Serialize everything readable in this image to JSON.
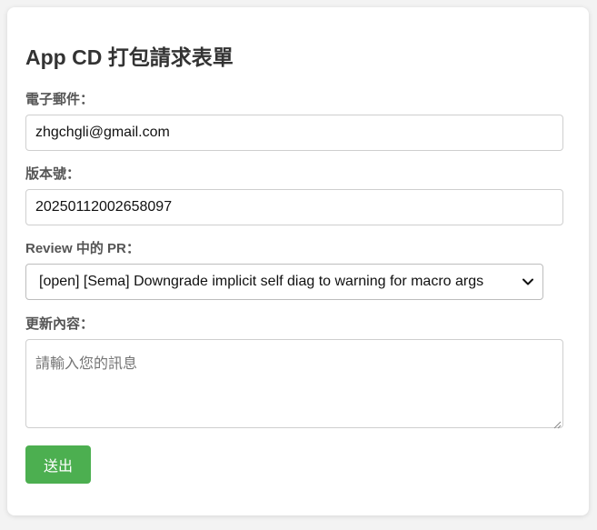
{
  "form": {
    "title": "App CD 打包請求表單",
    "email": {
      "label": "電子郵件：",
      "value": "zhgchgli@gmail.com"
    },
    "version": {
      "label": "版本號：",
      "value": "20250112002658097"
    },
    "pr": {
      "label": "Review 中的 PR：",
      "selected": "[open] [Sema] Downgrade implicit self diag to warning for macro args",
      "chevron_icon": "chevron-down-icon"
    },
    "notes": {
      "label": "更新內容：",
      "placeholder": "請輸入您的訊息",
      "value": ""
    },
    "submit_label": "送出"
  },
  "colors": {
    "page_background": "#f3f3f3",
    "card_background": "#ffffff",
    "submit_button": "#4caf50",
    "title_text": "#333333",
    "label_text": "#555555"
  }
}
